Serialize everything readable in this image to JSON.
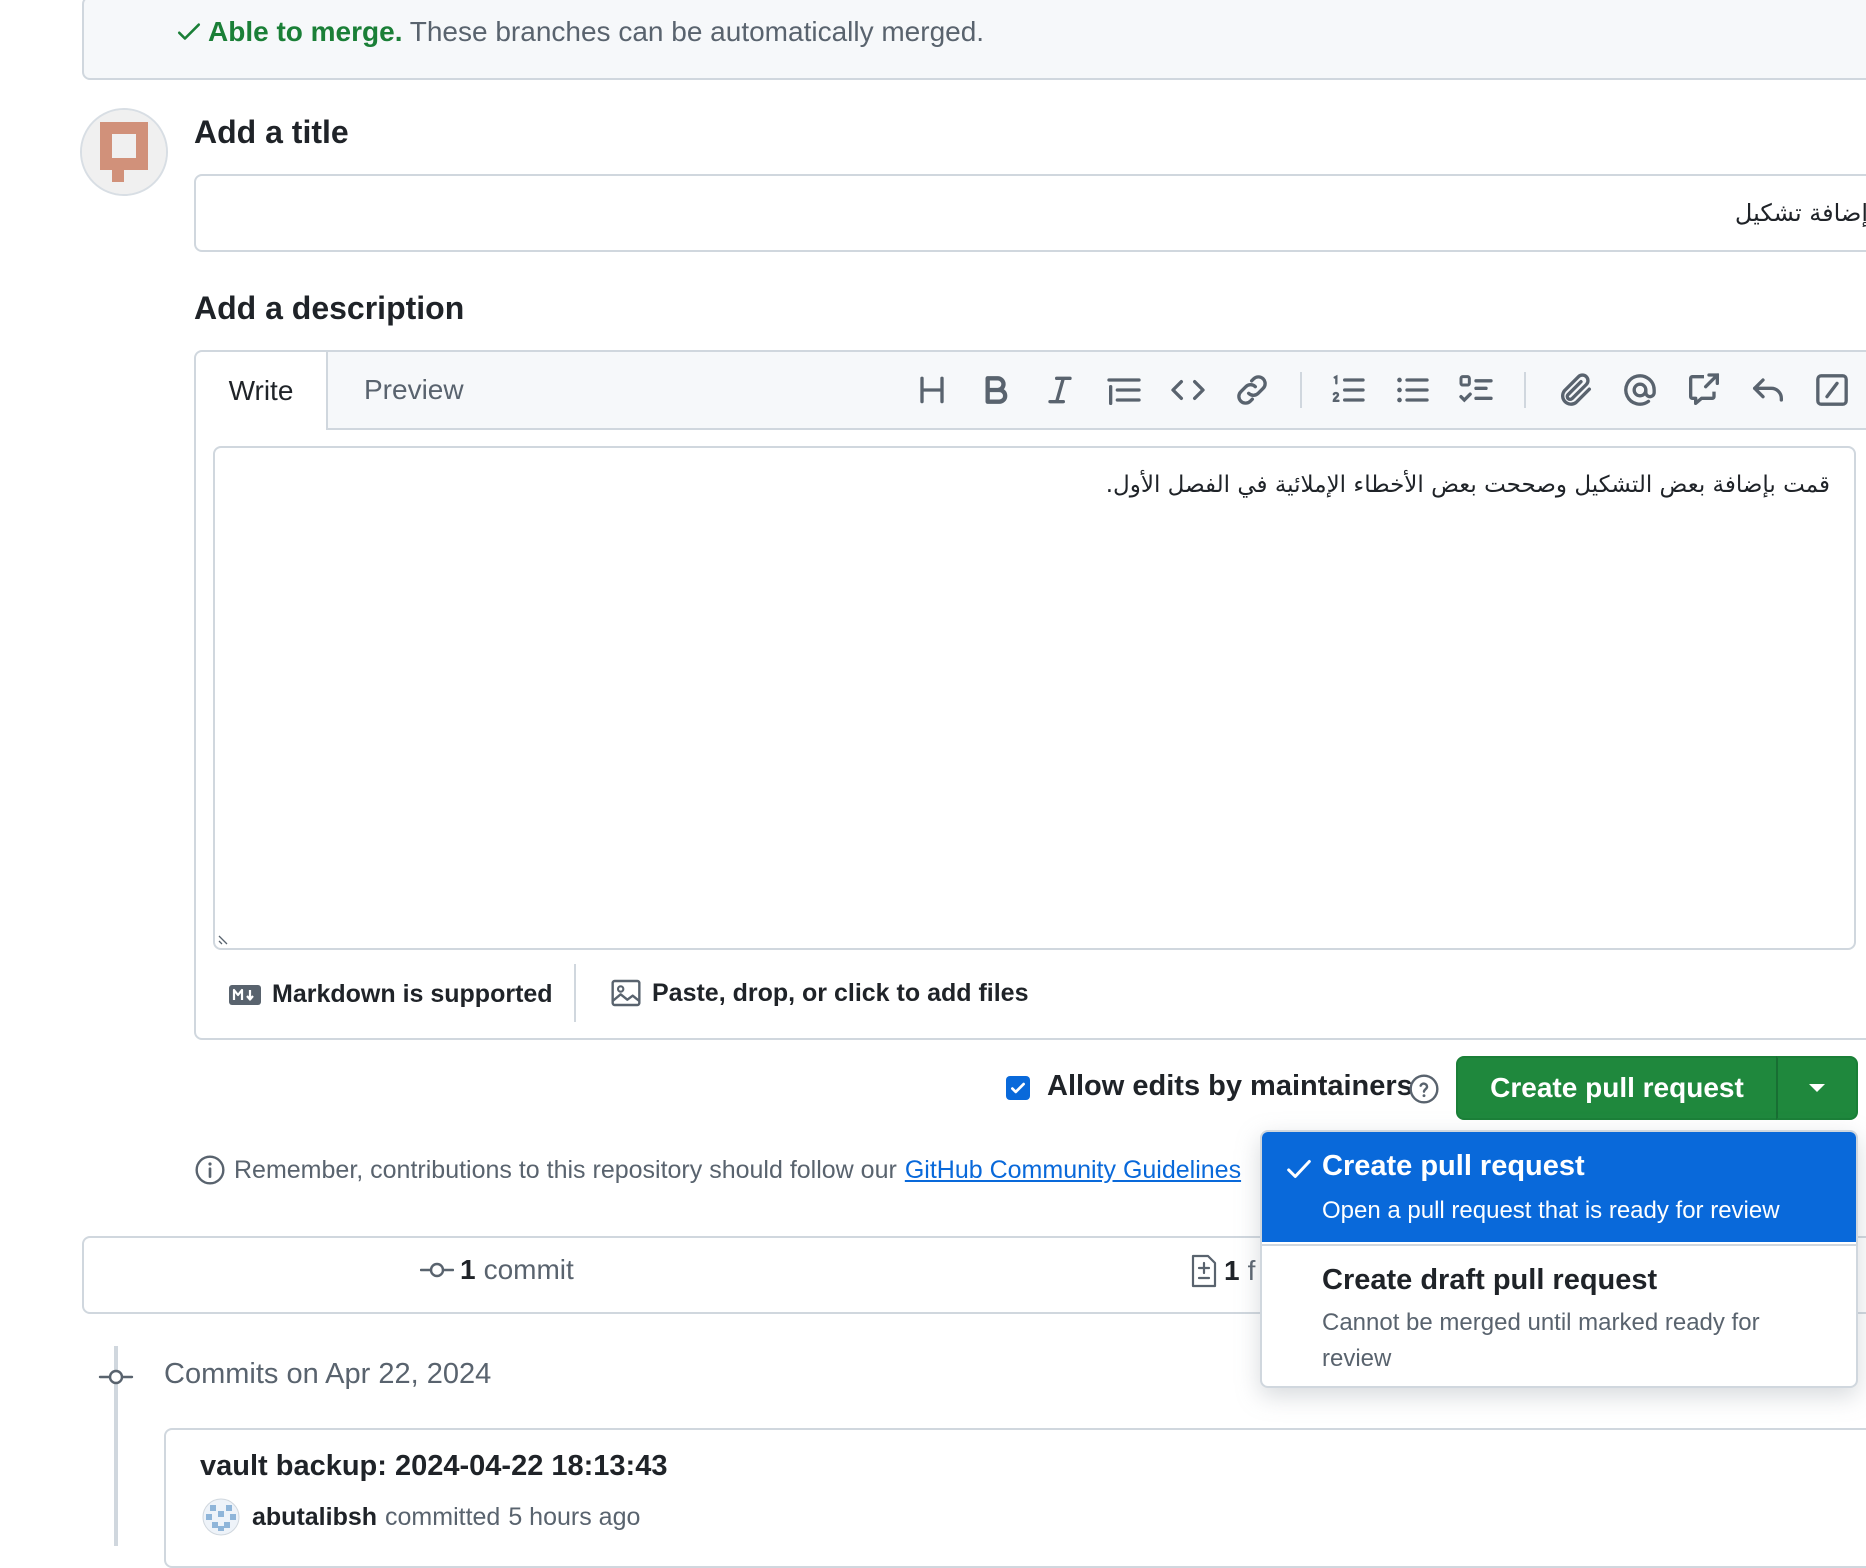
{
  "merge": {
    "status": "Able to merge.",
    "message": " These branches can be automatically merged."
  },
  "form": {
    "title_label": "Add a title",
    "title_value": "إضافة تشكيل",
    "description_label": "Add a description"
  },
  "editor": {
    "tabs": [
      "Write",
      "Preview"
    ],
    "active_tab": "Write",
    "toolbar_icons": [
      "heading-icon",
      "bold-icon",
      "italic-icon",
      "quote-icon",
      "code-icon",
      "link-icon",
      "ordered-list-icon",
      "unordered-list-icon",
      "task-list-icon",
      "attach-icon",
      "mention-icon",
      "reference-icon",
      "reply-icon",
      "slash-command-icon"
    ],
    "body": "قمت بإضافة بعض التشكيل وصححت بعض الأخطاء الإملائية في الفصل الأول.",
    "markdown_hint": "Markdown is supported",
    "attach_hint": "Paste, drop, or click to add files"
  },
  "submit": {
    "allow_edits_label": "Allow edits by maintainers",
    "allow_edits_checked": true,
    "button_label": "Create pull request"
  },
  "dropdown": {
    "items": [
      {
        "title": "Create pull request",
        "description": "Open a pull request that is ready for review",
        "selected": true
      },
      {
        "title": "Create draft pull request",
        "description": "Cannot be merged until marked ready for review",
        "selected": false
      }
    ]
  },
  "notice": {
    "text": "Remember, contributions to this repository should follow our",
    "link": "GitHub Community Guidelines"
  },
  "stats": {
    "commits_count": "1",
    "commits_label": "commit",
    "files_count": "1",
    "files_label": "f"
  },
  "commits": {
    "date_heading": "Commits on Apr 22, 2024",
    "items": [
      {
        "message": "vault backup: 2024-04-22 18:13:43",
        "author": "abutalibsh",
        "action": "committed",
        "time": "5 hours ago"
      }
    ]
  },
  "colors": {
    "accent": "#0969da",
    "success": "#1a7f37",
    "button": "#1f883d",
    "border": "#d0d7de",
    "muted_text": "#59636e"
  }
}
